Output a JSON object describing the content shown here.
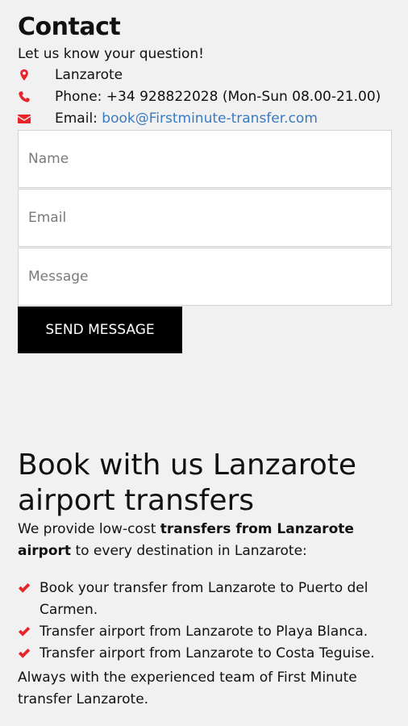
{
  "contact": {
    "title": "Contact",
    "subtitle": "Let us know your question!",
    "location": "Lanzarote",
    "phone": "Phone: +34 928822028 (Mon-Sun 08.00-21.00)",
    "email_label": "Email: ",
    "email": "book@Firstminute-transfer.com",
    "icons": [
      "map-marker-icon",
      "phone-icon",
      "envelope-icon"
    ],
    "icon_color": "#e8242b",
    "link_color": "#3a7bc0"
  },
  "form": {
    "name_placeholder": "Name",
    "email_placeholder": "Email",
    "message_placeholder": "Message",
    "send_label": "SEND MESSAGE",
    "button_color": "#000000"
  },
  "book": {
    "title": "Book with us Lanzarote airport transfers",
    "intro_pre": "We provide low-cost ",
    "intro_bold": "transfers from Lanzarote airport",
    "intro_post": " to every destination in Lanzarote:",
    "items": [
      "Book your transfer from Lanzarote to Puerto del Carmen.",
      "Transfer airport from Lanzarote to Playa Blanca.",
      "Transfer airport from Lanzarote to Costa Teguise."
    ],
    "outro": "Always with the experienced team of First Minute transfer Lanzarote.",
    "check_icon": "checkmark-icon",
    "check_color": "#e8242b"
  }
}
